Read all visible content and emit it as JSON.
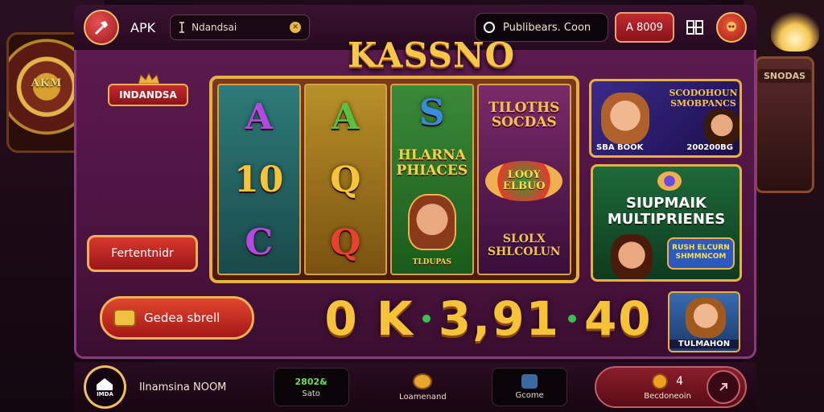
{
  "header": {
    "app_label": "APK",
    "search_value": "Ndandsai",
    "coin_pill_text": "Publibears. Coon",
    "balance_button": "A 8009"
  },
  "banner": {
    "title": "KASSNO",
    "country_badge": "INDANDSA",
    "feature_button": "Fertentnidr",
    "generate_button": "Gedea sbrell"
  },
  "background": {
    "wheel_label": "AKM",
    "slot_label": "SNODAS"
  },
  "reels": {
    "reel1": [
      "A",
      "10",
      "C"
    ],
    "reel2": [
      "A",
      "Q",
      "Q"
    ],
    "reel3_symbol": "S",
    "reel3_text": "HLARNA PHIACES",
    "reel3_stamp": "TLDUPAS",
    "reel4_title": "TILOTHS SOCDAS",
    "reel4_badge": "LOOY ELBUO",
    "reel4_bottom": "SLOLX SHLCOLUN"
  },
  "cards": {
    "card1_title": "SCODOHOUN SMOBPANCS",
    "card1_left": "SBA BOOK",
    "card1_right": "200200BG",
    "card2_title": "SIUPMAIK MULTIPRIENES",
    "card2_badge": "RUSH ELCURN SHMMNCOM",
    "card3_label": "TULMAHON"
  },
  "jackpot": {
    "part1": "0 K",
    "part2": "3,91",
    "part3": "40",
    "separator_color": "#3ac050"
  },
  "bottom_nav": {
    "home_label": "IMDA",
    "title": "Ilnamsina NOOM",
    "item1_value": "2802&",
    "item1_label": "Sato",
    "item2_label": "Loamenand",
    "item3_label": "Gcome",
    "promo_number": "4",
    "promo_label": "Becdoneoin"
  },
  "colors": {
    "accent_gold": "#f5c23a",
    "frame_purple": "#5a1a4e",
    "button_red": "#c02a30"
  }
}
